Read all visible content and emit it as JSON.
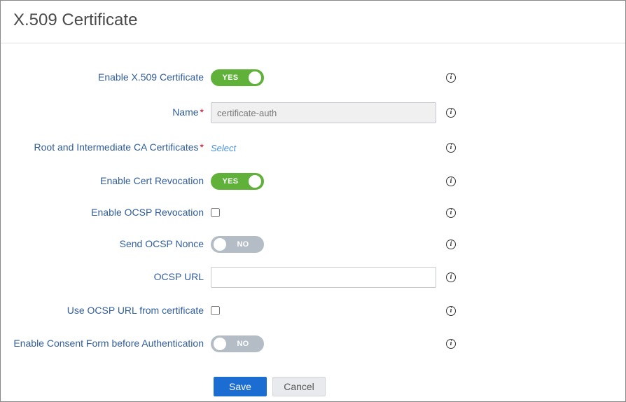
{
  "title": "X.509 Certificate",
  "fields": {
    "enable_x509": {
      "label": "Enable X.509 Certificate",
      "state": "on",
      "on_text": "YES",
      "off_text": "NO"
    },
    "name": {
      "label": "Name",
      "required": true,
      "value": "certificate-auth"
    },
    "root_ca": {
      "label": "Root and Intermediate CA Certificates",
      "required": true,
      "select_text": "Select"
    },
    "enable_cert_rev": {
      "label": "Enable Cert Revocation",
      "state": "on",
      "on_text": "YES",
      "off_text": "NO"
    },
    "enable_ocsp_rev": {
      "label": "Enable OCSP Revocation",
      "checked": false
    },
    "send_ocsp_nonce": {
      "label": "Send OCSP Nonce",
      "state": "off",
      "on_text": "YES",
      "off_text": "NO"
    },
    "ocsp_url": {
      "label": "OCSP URL",
      "value": ""
    },
    "use_ocsp_url_cert": {
      "label": "Use OCSP URL from certificate",
      "checked": false
    },
    "enable_consent": {
      "label": "Enable Consent Form before Authentication",
      "state": "off",
      "on_text": "YES",
      "off_text": "NO"
    }
  },
  "buttons": {
    "save": "Save",
    "cancel": "Cancel"
  },
  "info_glyph": "i"
}
